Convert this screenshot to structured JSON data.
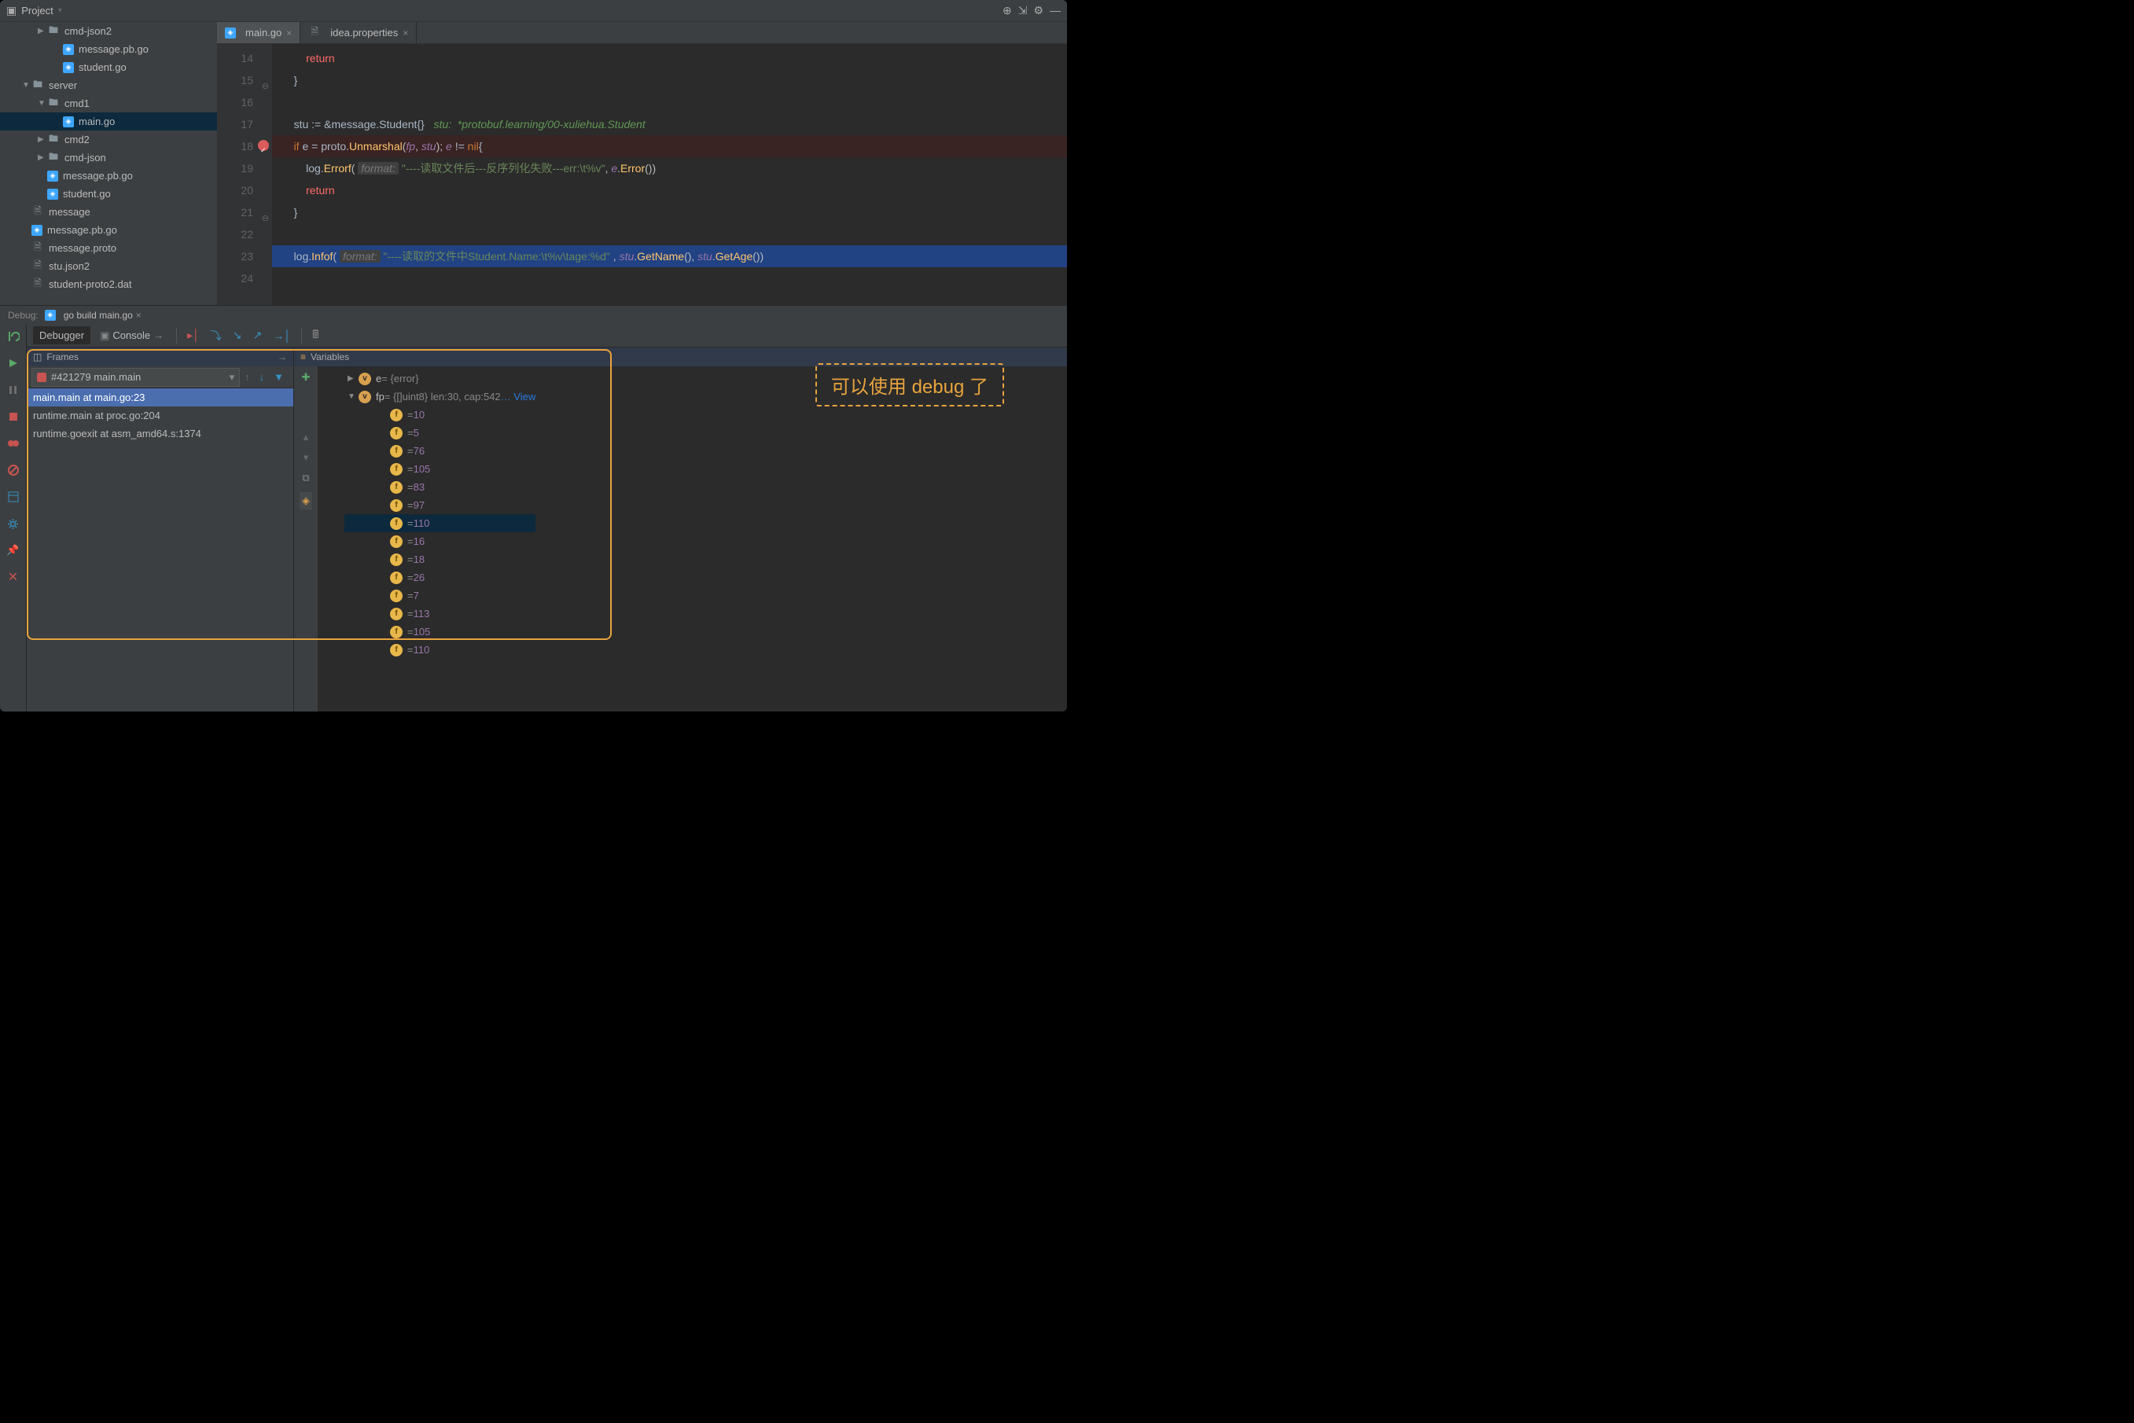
{
  "project_header": {
    "title": "Project"
  },
  "tree": [
    {
      "depth": 2,
      "arrow": "▶",
      "icon": "folder",
      "name": "cmd-json2"
    },
    {
      "depth": 3,
      "arrow": "",
      "icon": "go",
      "name": "message.pb.go"
    },
    {
      "depth": 3,
      "arrow": "",
      "icon": "go",
      "name": "student.go"
    },
    {
      "depth": 1,
      "arrow": "▼",
      "icon": "folder",
      "name": "server"
    },
    {
      "depth": 2,
      "arrow": "▼",
      "icon": "folder",
      "name": "cmd1"
    },
    {
      "depth": 3,
      "arrow": "",
      "icon": "go",
      "name": "main.go",
      "selected": true
    },
    {
      "depth": 2,
      "arrow": "▶",
      "icon": "folder",
      "name": "cmd2"
    },
    {
      "depth": 2,
      "arrow": "▶",
      "icon": "folder",
      "name": "cmd-json"
    },
    {
      "depth": 2,
      "arrow": "",
      "icon": "go",
      "name": "message.pb.go"
    },
    {
      "depth": 2,
      "arrow": "",
      "icon": "go",
      "name": "student.go"
    },
    {
      "depth": 1,
      "arrow": "",
      "icon": "file",
      "name": "message"
    },
    {
      "depth": 1,
      "arrow": "",
      "icon": "go",
      "name": "message.pb.go"
    },
    {
      "depth": 1,
      "arrow": "",
      "icon": "file",
      "name": "message.proto"
    },
    {
      "depth": 1,
      "arrow": "",
      "icon": "file",
      "name": "stu.json2"
    },
    {
      "depth": 1,
      "arrow": "",
      "icon": "file",
      "name": "student-proto2.dat"
    }
  ],
  "tabs": [
    {
      "label": "main.go",
      "icon": "go",
      "active": true
    },
    {
      "label": "idea.properties",
      "icon": "file",
      "active": false
    }
  ],
  "gutter": [
    {
      "num": "14"
    },
    {
      "num": "15",
      "fold": true
    },
    {
      "num": "16"
    },
    {
      "num": "17"
    },
    {
      "num": "18",
      "bp": true
    },
    {
      "num": "19"
    },
    {
      "num": "20"
    },
    {
      "num": "21",
      "fold": true
    },
    {
      "num": "22"
    },
    {
      "num": "23"
    },
    {
      "num": "24"
    }
  ],
  "code_strings": {
    "l14": "return",
    "l17_comment": "stu:  *protobuf.learning/00-xuliehua.Student",
    "l19_str": "\"----读取文件后---反序列化失败---err:\\t%v\"",
    "l23_str": "\"----读取的文件中Student.Name:\\t%v\\tage:%d\" "
  },
  "debug": {
    "label": "Debug:",
    "run_config": "go build main.go",
    "tabs": {
      "debugger": "Debugger",
      "console": "Console"
    },
    "frames_title": "Frames",
    "vars_title": "Variables",
    "thread": "#421279 main.main",
    "frames": [
      {
        "text": "main.main at main.go:23",
        "active": true
      },
      {
        "text": "runtime.main at proc.go:204",
        "active": false
      },
      {
        "text": "runtime.goexit at asm_amd64.s:1374",
        "active": false
      }
    ],
    "vars": {
      "e": {
        "badge": "v",
        "name": "e",
        "val": "= {error}"
      },
      "fp": {
        "badge": "v",
        "name": "fp",
        "val": "= {[]uint8} len:30, cap:542",
        "link": "… View"
      },
      "items": [
        "= 10",
        "= 5",
        "= 76",
        "= 105",
        "= 83",
        "= 97",
        "= 110",
        "= 16",
        "= 18",
        "= 26",
        "= 7",
        "= 113",
        "= 105",
        "= 110"
      ]
    }
  },
  "annotation": "可以使用 debug 了"
}
